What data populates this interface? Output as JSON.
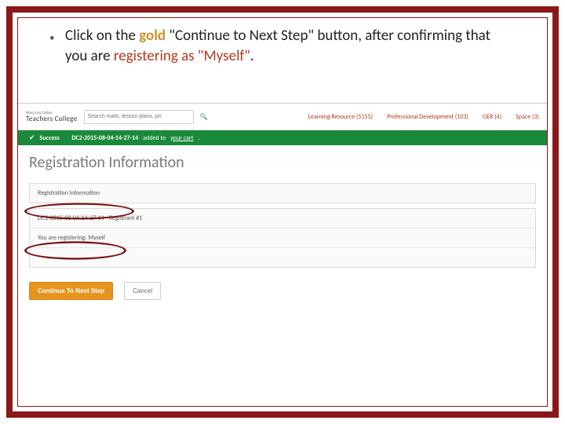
{
  "instruction": {
    "prefix": "Click on the ",
    "gold_word": "gold",
    "mid": " \"Continue to Next Step\" button, after confirming that you are ",
    "red_phrase": "registering as \"Myself\"",
    "suffix": "."
  },
  "logo": {
    "line1": "Mary Lou Fulton",
    "line2": "Teachers College"
  },
  "search": {
    "placeholder": "Search math, lesson plans, pri"
  },
  "nav": {
    "learning": "Learning Resource (5155)",
    "pd": "Professional Development (103)",
    "oer": "OER (4)",
    "space": "Space (3)"
  },
  "success": {
    "label": "Success",
    "item": "DC2-2015-08-04-14-27-14",
    "msg_mid": " added to ",
    "cart": "your cart"
  },
  "page_title": "Registration Information",
  "panel1": {
    "header": "Registration Information"
  },
  "panel2": {
    "row1": "DC2-2015-08-04-14-27-14 - Registrant #1",
    "row2": "You are registering: Myself"
  },
  "buttons": {
    "continue": "Continue To Next Step",
    "cancel": "Cancel"
  }
}
